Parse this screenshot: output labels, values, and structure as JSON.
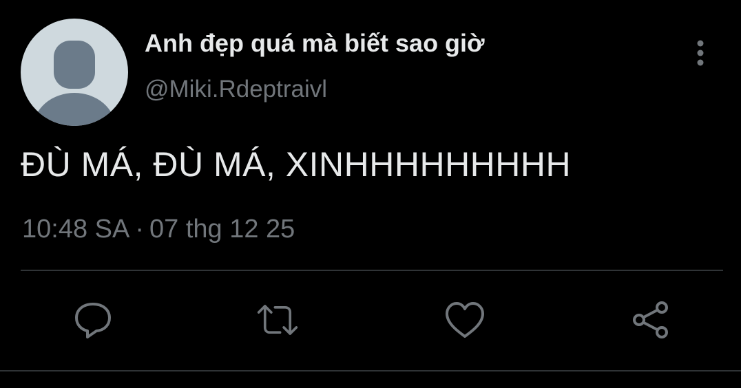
{
  "user": {
    "display_name": "Anh đẹp quá mà biết sao giờ",
    "handle": "@Miki.Rdeptraivl"
  },
  "tweet": {
    "text": "ĐÙ MÁ, ĐÙ MÁ, XINHHHHHHHHH",
    "time": "10:48 SA",
    "separator": "·",
    "date": "07 thg 12 25"
  },
  "icons": {
    "more": "more-vertical-icon",
    "reply": "reply-icon",
    "retweet": "retweet-icon",
    "like": "heart-icon",
    "share": "share-icon",
    "avatar": "default-avatar-icon"
  },
  "colors": {
    "background": "#000000",
    "primary_text": "#e7e9ea",
    "secondary_text": "#71767b",
    "divider": "#2f3336",
    "avatar_bg": "#cfd9de",
    "avatar_silhouette": "#6b7b8a"
  }
}
